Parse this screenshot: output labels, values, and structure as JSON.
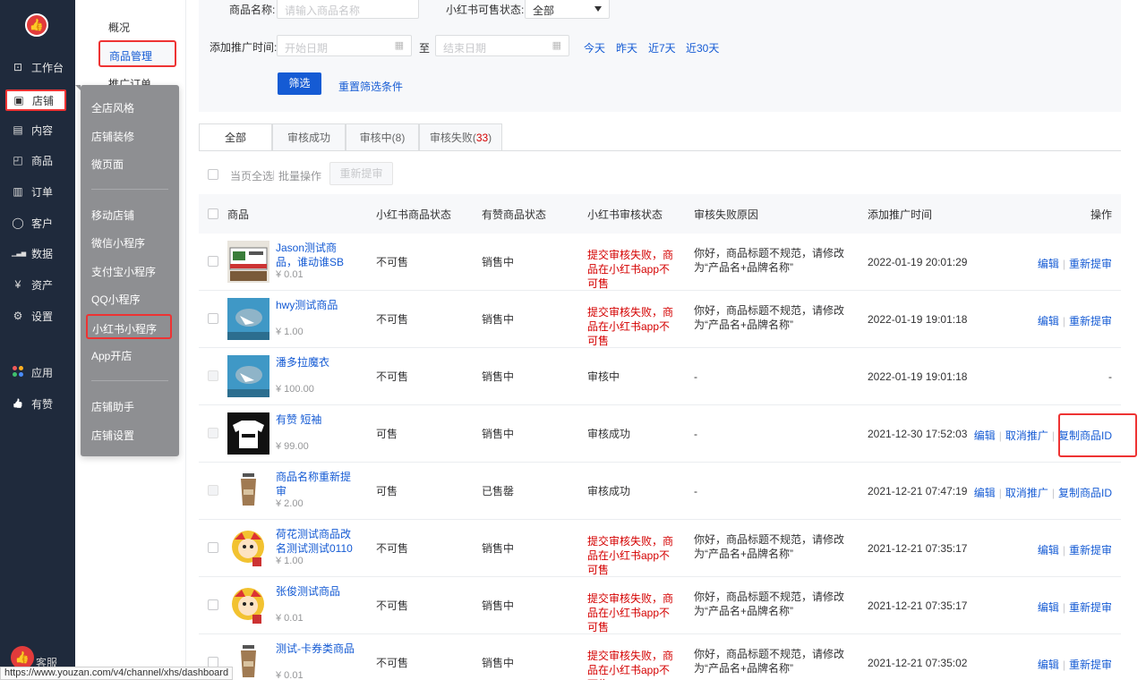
{
  "sidebar": {
    "items": [
      {
        "icon": "monitor-icon",
        "glyph": "⊡",
        "label": "工作台"
      },
      {
        "icon": "store-icon",
        "glyph": "▣",
        "label": "店铺"
      },
      {
        "icon": "document-icon",
        "glyph": "▤",
        "label": "内容"
      },
      {
        "icon": "bag-icon",
        "glyph": "◰",
        "label": "商品"
      },
      {
        "icon": "order-icon",
        "glyph": "▥",
        "label": "订单"
      },
      {
        "icon": "user-icon",
        "glyph": "◯",
        "label": "客户"
      },
      {
        "icon": "chart-icon",
        "glyph": "▁▃▅",
        "label": "数据"
      },
      {
        "icon": "yen-icon",
        "glyph": "¥",
        "label": "资产"
      },
      {
        "icon": "gear-icon",
        "glyph": "⚙",
        "label": "设置"
      },
      {
        "icon": "apps-icon",
        "glyph": "",
        "label": "应用"
      },
      {
        "icon": "thumbs-up-icon",
        "glyph": "👍",
        "label": "有赞"
      }
    ],
    "service_label": "客服"
  },
  "subnav": {
    "items": [
      "概况",
      "商品管理",
      "推广订单"
    ]
  },
  "flyout": {
    "items": [
      "全店风格",
      "店铺装修",
      "微页面",
      "移动店铺",
      "微信小程序",
      "支付宝小程序",
      "QQ小程序",
      "小红书小程序",
      "App开店",
      "店铺助手",
      "店铺设置"
    ]
  },
  "filter": {
    "name_label": "商品名称:",
    "name_placeholder": "请输入商品名称",
    "sale_status_label": "小红书可售状态:",
    "sale_status_value": "全部",
    "time_label": "添加推广时间:",
    "start_placeholder": "开始日期",
    "to_label": "至",
    "end_placeholder": "结束日期",
    "quick": [
      "今天",
      "昨天",
      "近7天",
      "近30天"
    ],
    "filter_button": "筛选",
    "reset_link": "重置筛选条件"
  },
  "tabs": [
    {
      "label": "全部",
      "count": ""
    },
    {
      "label": "审核成功",
      "count": ""
    },
    {
      "label": "审核中(8)",
      "count": ""
    },
    {
      "label": "审核失败(",
      "count": "33",
      "suffix": ")"
    }
  ],
  "batch": {
    "select_page": "当页全选",
    "batch_ops": "批量操作",
    "resubmit": "重新提审"
  },
  "table": {
    "headers": [
      "商品",
      "小红书商品状态",
      "有赞商品状态",
      "小红书审核状态",
      "审核失败原因",
      "添加推广时间",
      "操作"
    ],
    "rows": [
      {
        "name": "Jason测试商品，谁动谁SB",
        "price": "¥ 0.01",
        "xhs_status": "不可售",
        "yz_status": "销售中",
        "audit": "提交审核失败，商品在小红书app不可售",
        "audit_fail": true,
        "reason": "你好，商品标题不规范，请修改为“产品名+品牌名称”",
        "time": "2022-01-19 20:01:29",
        "ops": [
          "编辑",
          "重新提审"
        ]
      },
      {
        "name": "hwy测试商品",
        "price": "¥ 1.00",
        "xhs_status": "不可售",
        "yz_status": "销售中",
        "audit": "提交审核失败，商品在小红书app不可售",
        "audit_fail": true,
        "reason": "你好，商品标题不规范，请修改为“产品名+品牌名称”",
        "time": "2022-01-19 19:01:18",
        "ops": [
          "编辑",
          "重新提审"
        ]
      },
      {
        "name": "潘多拉魔衣",
        "price": "¥ 100.00",
        "xhs_status": "不可售",
        "yz_status": "销售中",
        "audit": "审核中",
        "audit_fail": false,
        "reason": "-",
        "time": "2022-01-19 19:01:18",
        "ops": [
          "-"
        ]
      },
      {
        "name": "有赞 短袖",
        "price": "¥ 99.00",
        "xhs_status": "可售",
        "yz_status": "销售中",
        "audit": "审核成功",
        "audit_fail": false,
        "reason": "-",
        "time": "2021-12-30 17:52:03",
        "ops": [
          "编辑",
          "取消推广",
          "复制商品ID"
        ]
      },
      {
        "name": "商品名称重新提审",
        "price": "¥ 2.00",
        "xhs_status": "可售",
        "yz_status": "已售罄",
        "audit": "审核成功",
        "audit_fail": false,
        "reason": "-",
        "time": "2021-12-21 07:47:19",
        "ops": [
          "编辑",
          "取消推广",
          "复制商品ID"
        ]
      },
      {
        "name": "荷花测试商品改名测试测试0110",
        "price": "¥ 1.00",
        "xhs_status": "不可售",
        "yz_status": "销售中",
        "audit": "提交审核失败，商品在小红书app不可售",
        "audit_fail": true,
        "reason": "你好，商品标题不规范，请修改为“产品名+品牌名称”",
        "time": "2021-12-21 07:35:17",
        "ops": [
          "编辑",
          "重新提审"
        ]
      },
      {
        "name": "张俊测试商品",
        "price": "¥ 0.01",
        "xhs_status": "不可售",
        "yz_status": "销售中",
        "audit": "提交审核失败，商品在小红书app不可售",
        "audit_fail": true,
        "reason": "你好，商品标题不规范，请修改为“产品名+品牌名称”",
        "time": "2021-12-21 07:35:17",
        "ops": [
          "编辑",
          "重新提审"
        ]
      },
      {
        "name": "测试-卡券类商品",
        "price": "¥ 0.01",
        "xhs_status": "不可售",
        "yz_status": "销售中",
        "audit": "提交审核失败，商品在小红书app不可售",
        "audit_fail": true,
        "reason": "你好，商品标题不规范，请修改为“产品名+品牌名称”",
        "time": "2021-12-21 07:35:02",
        "ops": [
          "编辑",
          "重新提审"
        ]
      }
    ]
  },
  "status_url": "https://www.youzan.com/v4/channel/xhs/dashboard",
  "colors": {
    "accent": "#155bd4",
    "danger": "#d40000",
    "highlight": "#e33333",
    "sidebar": "#1f2a3c"
  }
}
